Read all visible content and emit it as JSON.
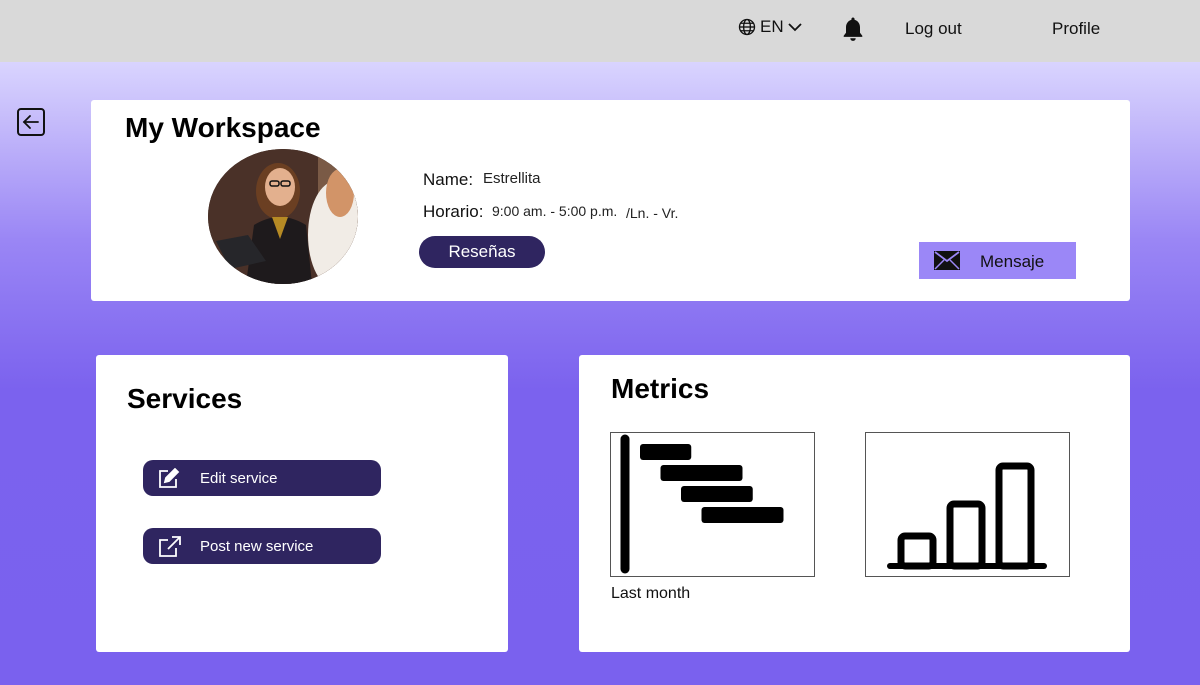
{
  "header": {
    "language": "EN",
    "logout_label": "Log out",
    "profile_label": "Profile"
  },
  "workspace": {
    "title": "My Workspace",
    "name_label": "Name:",
    "name_value": "Estrellita",
    "horario_label": "Horario:",
    "horario_value": "9:00 am. - 5:00 p.m.",
    "horario_days": "/Ln. - Vr.",
    "resenas_label": "Reseñas",
    "mensaje_label": "Mensaje"
  },
  "services": {
    "title": "Services",
    "edit_label": "Edit service",
    "post_label": "Post new service"
  },
  "metrics": {
    "title": "Metrics",
    "caption": "Last month"
  },
  "chart_data": [
    {
      "type": "bar",
      "orientation": "horizontal",
      "categories": [
        "",
        "",
        "",
        ""
      ],
      "values": [
        2.5,
        4,
        3.5,
        4
      ],
      "offsets": [
        0,
        1,
        2,
        3
      ]
    },
    {
      "type": "bar",
      "orientation": "vertical",
      "categories": [
        "",
        "",
        ""
      ],
      "values": [
        30,
        62,
        100
      ]
    }
  ],
  "colors": {
    "accent_dark": "#2f2560",
    "accent_light": "#9b87f7",
    "topbar": "#d9d9d9"
  },
  "icons": [
    "globe-icon",
    "chevron-down-icon",
    "bell-icon",
    "back-arrow-icon",
    "mail-icon",
    "edit-icon",
    "external-link-icon"
  ]
}
